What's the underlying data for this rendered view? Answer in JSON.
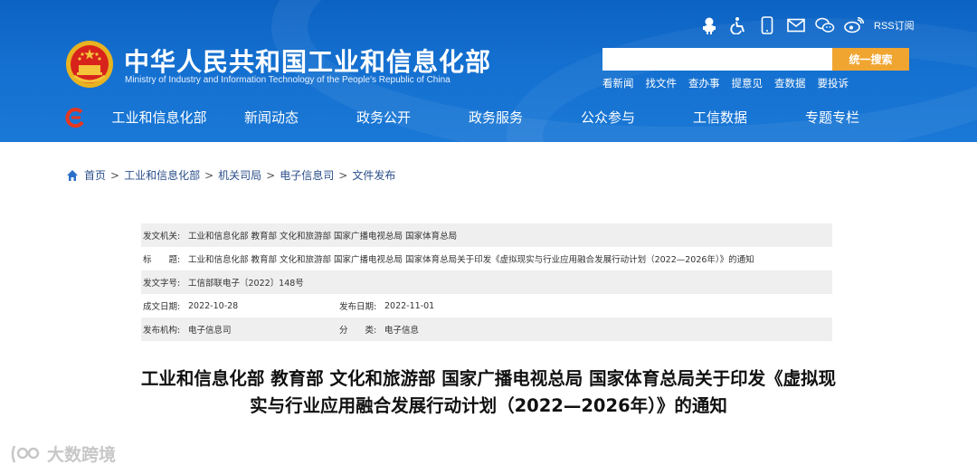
{
  "header": {
    "title": "中华人民共和国工业和信息化部",
    "subtitle": "Ministry of Industry and Information Technology of the People's Republic of China",
    "emblem_icon": "national-emblem-icon",
    "top_icons": [
      "mascot-icon",
      "accessibility-icon",
      "mobile-icon",
      "mail-icon",
      "wechat-icon",
      "weibo-icon"
    ],
    "rss_label": "RSS订阅",
    "search": {
      "placeholder": "",
      "value": "",
      "button_label": "统一搜索"
    },
    "quick_links": [
      "看新闻",
      "找文件",
      "查办事",
      "提意见",
      "查数据",
      "要投诉"
    ],
    "nav": [
      "工业和信息化部",
      "新闻动态",
      "政务公开",
      "政务服务",
      "公众参与",
      "工信数据",
      "专题专栏"
    ],
    "colors": {
      "banner": "#1470d0",
      "search_button": "#f0a531"
    }
  },
  "breadcrumb": [
    "首页",
    "工业和信息化部",
    "机关司局",
    "电子信息司",
    "文件发布"
  ],
  "info": {
    "issuer_label": "发文机关:",
    "issuer": "工业和信息化部 教育部 文化和旅游部 国家广播电视总局 国家体育总局",
    "subject_label": "标　　题:",
    "subject": "工业和信息化部 教育部 文化和旅游部 国家广播电视总局 国家体育总局关于印发《虚拟现实与行业应用融合发展行动计划（2022—2026年）》的通知",
    "doc_no_label": "发文字号:",
    "doc_no": "工信部联电子〔2022〕148号",
    "written_date_label": "成文日期:",
    "written_date": "2022-10-28",
    "publish_date_label": "发布日期:",
    "publish_date": "2022-11-01",
    "org_label": "发布机构:",
    "org": "电子信息司",
    "category_label": "分　　类:",
    "category": "电子信息"
  },
  "article": {
    "title": "工业和信息化部 教育部 文化和旅游部 国家广播电视总局 国家体育总局关于印发《虚拟现实与行业应用融合发展行动计划（2022—2026年）》的通知"
  },
  "watermark": {
    "text": "大数跨境"
  }
}
